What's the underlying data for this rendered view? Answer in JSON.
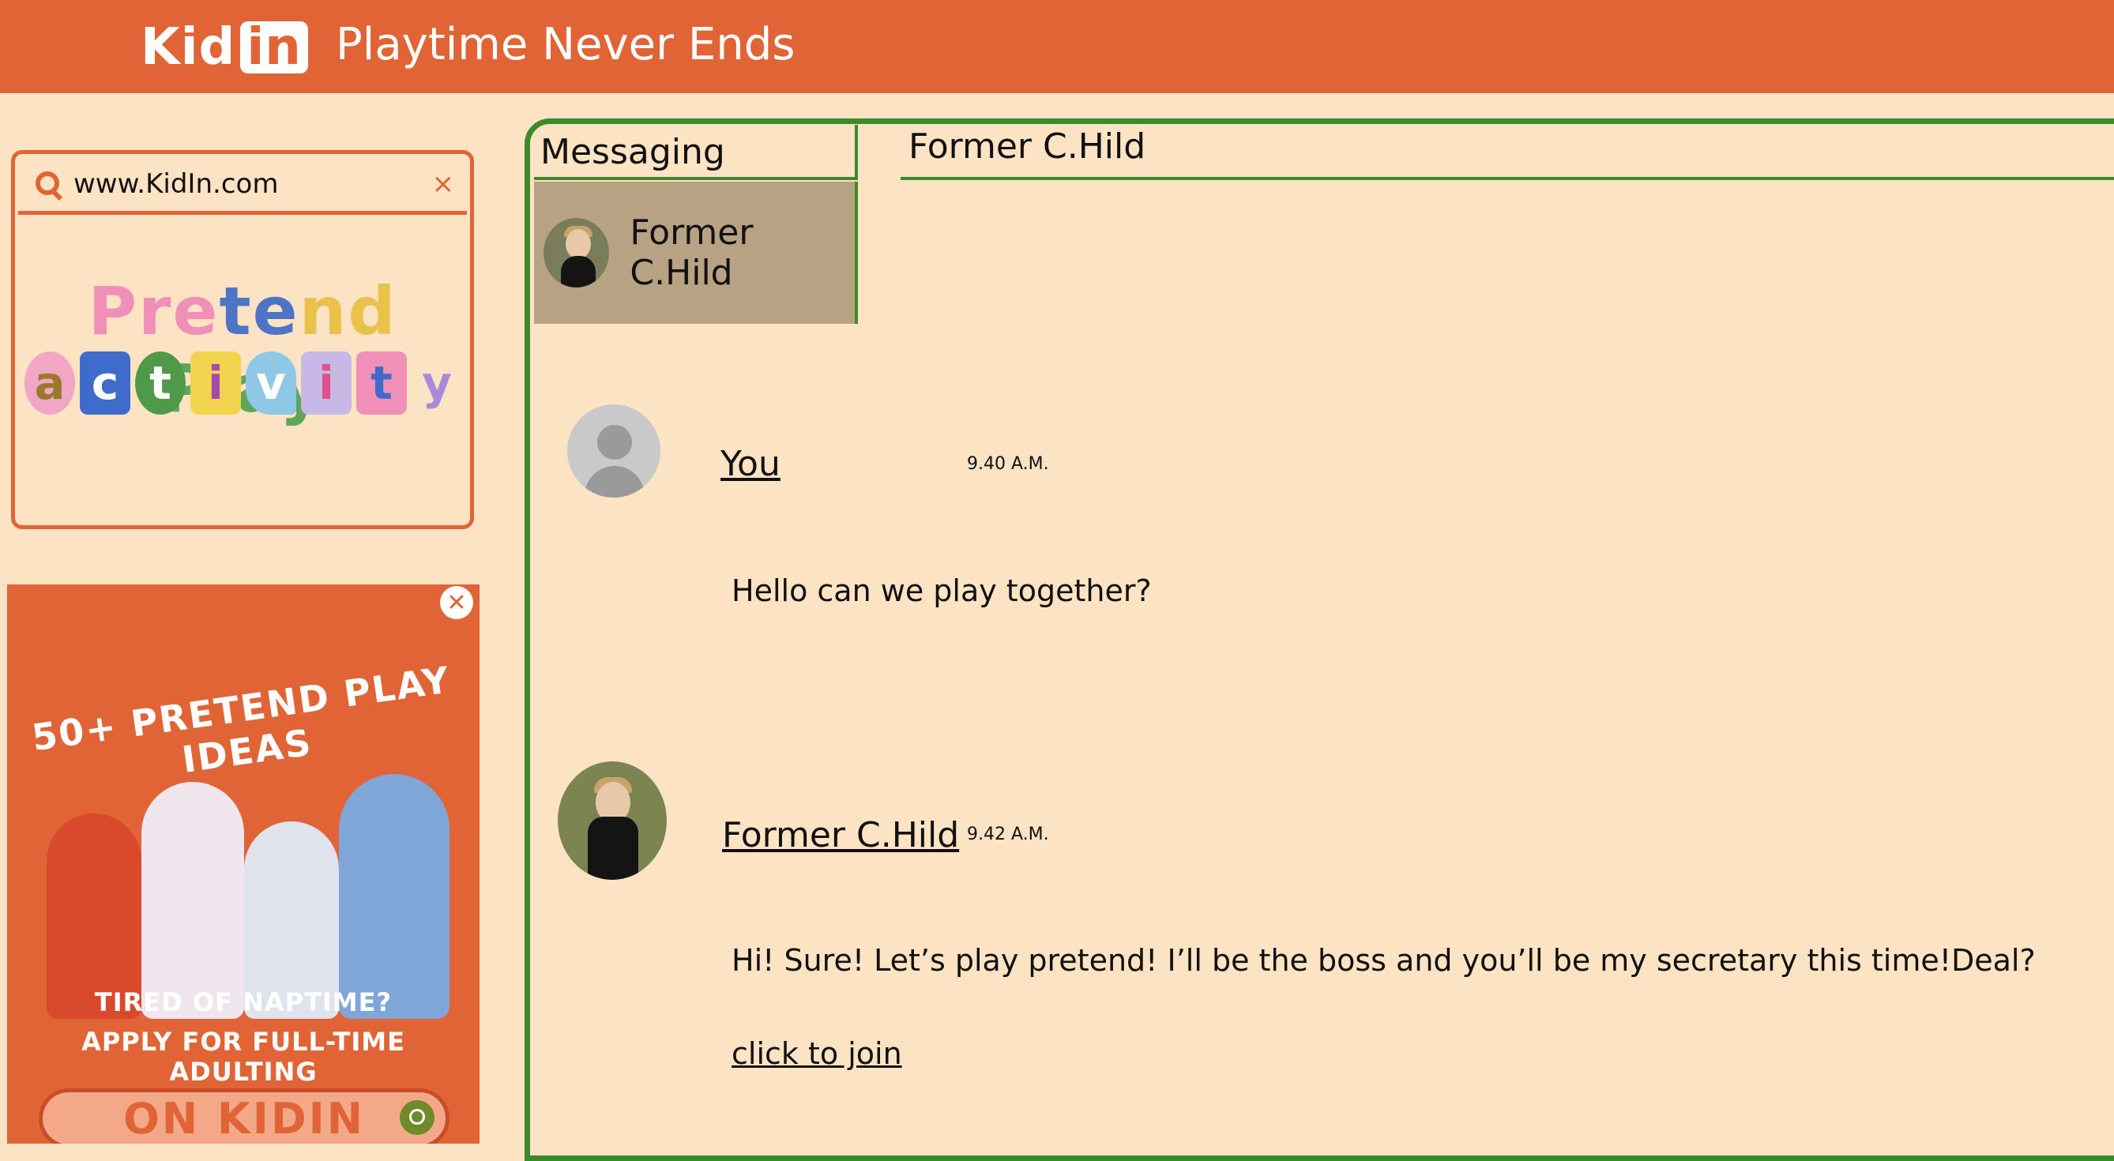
{
  "header": {
    "logo_prefix": "Kid",
    "logo_suffix": "in",
    "tagline": "Playtime Never Ends",
    "color": "#e06435"
  },
  "search": {
    "value": "www.KidIn.com",
    "clear_glyph": "×",
    "card_title_words": [
      "Pre",
      "te",
      "nd",
      " Play"
    ],
    "activity_letters": [
      "a",
      "c",
      "t",
      "i",
      "v",
      "i",
      "t",
      "y"
    ]
  },
  "ad": {
    "close_glyph": "✕",
    "headline": "50+ PRETEND PLAY IDEAS",
    "line1": "TIRED OF NAPTIME?",
    "line2": "APPLY FOR FULL-TIME ADULTING",
    "cta": "ON KIDIN"
  },
  "messaging": {
    "tab_label": "Messaging",
    "conversations": [
      {
        "name": "Former C.Hild"
      }
    ],
    "chat_title": "Former C.Hild",
    "messages": [
      {
        "sender": "You",
        "time": "9.40 A.M.",
        "text": "Hello can we play together?"
      },
      {
        "sender": "Former C.Hild",
        "time": "9.42 A.M.",
        "text": "Hi! Sure! Let’s play pretend! I’ll be the boss and you’ll be my secretary this time!Deal?",
        "link": "click to join"
      }
    ]
  },
  "colors": {
    "background": "#fbe3c4",
    "accent": "#e06435",
    "panel_border": "#3d8a2a",
    "selected_conversation": "#b8a284"
  }
}
